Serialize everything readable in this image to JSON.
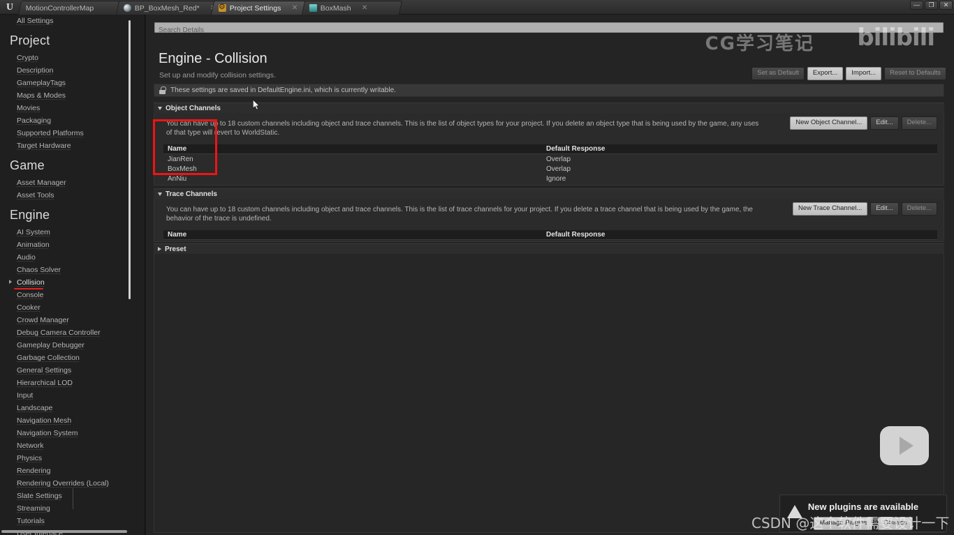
{
  "window": {
    "minimize_label": "—",
    "maximize_label": "❐",
    "close_label": "✕",
    "logo_label": "U"
  },
  "tabs": [
    {
      "label": "MotionControllerMap",
      "icon": "",
      "close": "",
      "active": false
    },
    {
      "label": "BP_BoxMesh_Red*",
      "icon": "sphere-icon",
      "close": "✕",
      "active": false
    },
    {
      "label": "Project Settings",
      "icon": "gear-icon",
      "close": "✕",
      "active": true
    },
    {
      "label": "BoxMash",
      "icon": "mesh-icon",
      "close": "✕",
      "active": false
    }
  ],
  "sidebar": {
    "all_settings": "All Settings",
    "groups": [
      {
        "heading": "Project",
        "items": [
          "Crypto",
          "Description",
          "GameplayTags",
          "Maps & Modes",
          "Movies",
          "Packaging",
          "Supported Platforms",
          "Target Hardware"
        ]
      },
      {
        "heading": "Game",
        "items": [
          "Asset Manager",
          "Asset Tools"
        ]
      },
      {
        "heading": "Engine",
        "items": [
          "AI System",
          "Animation",
          "Audio",
          "Chaos Solver",
          "Collision",
          "Console",
          "Cooker",
          "Crowd Manager",
          "Debug Camera Controller",
          "Gameplay Debugger",
          "Garbage Collection",
          "General Settings",
          "Hierarchical LOD",
          "Input",
          "Landscape",
          "Navigation Mesh",
          "Navigation System",
          "Network",
          "Physics",
          "Rendering",
          "Rendering Overrides (Local)",
          "Slate Settings",
          "Streaming",
          "Tutorials",
          "User Interface"
        ]
      }
    ],
    "selected": "Collision"
  },
  "search": {
    "value": "",
    "placeholder": "Search Details"
  },
  "page": {
    "title": "Engine - Collision",
    "subtitle": "Set up and modify collision settings.",
    "info_message": "These settings are saved in DefaultEngine.ini, which is currently writable."
  },
  "header_buttons": [
    {
      "label": "Set as Default",
      "style": "dim"
    },
    {
      "label": "Export...",
      "style": "light"
    },
    {
      "label": "Import...",
      "style": "light"
    },
    {
      "label": "Reset to Defaults",
      "style": "dim"
    }
  ],
  "object_channels": {
    "section_title": "Object Channels",
    "description": "You can have up to 18 custom channels including object and trace channels. This is the list of object types for your project. If you delete an object type that is being used by the game, any uses of that type will revert to WorldStatic.",
    "buttons": [
      {
        "label": "New Object Channel...",
        "style": "light"
      },
      {
        "label": "Edit...",
        "style": "normal"
      },
      {
        "label": "Delete...",
        "style": "dim"
      }
    ],
    "columns": [
      "Name",
      "Default Response"
    ],
    "rows": [
      {
        "name": "JianRen",
        "response": "Overlap"
      },
      {
        "name": "BoxMesh",
        "response": "Overlap"
      },
      {
        "name": "AnNiu",
        "response": "Ignore"
      }
    ]
  },
  "trace_channels": {
    "section_title": "Trace Channels",
    "description": "You can have up to 18 custom channels including object and trace channels. This is the list of trace channels for your project. If you delete a trace channel that is being used by the game, the behavior of the trace is undefined.",
    "buttons": [
      {
        "label": "New Trace Channel...",
        "style": "light"
      },
      {
        "label": "Edit...",
        "style": "normal"
      },
      {
        "label": "Delete...",
        "style": "dim"
      }
    ],
    "columns": [
      "Name",
      "Default Response"
    ],
    "rows": []
  },
  "preset": {
    "section_title": "Preset"
  },
  "notification": {
    "title": "New plugins are available",
    "primary_button": "Manage Plugins",
    "secondary_button": "Dismiss"
  },
  "watermarks": {
    "cg": "CG学习笔记",
    "bilibili": "bilibili",
    "csdn": "CSDN @这个软件需要设计一下"
  },
  "colors": {
    "annotation_red": "#f01414",
    "panel_bg": "#242424",
    "sidebar_bg": "#1f1f1f"
  }
}
